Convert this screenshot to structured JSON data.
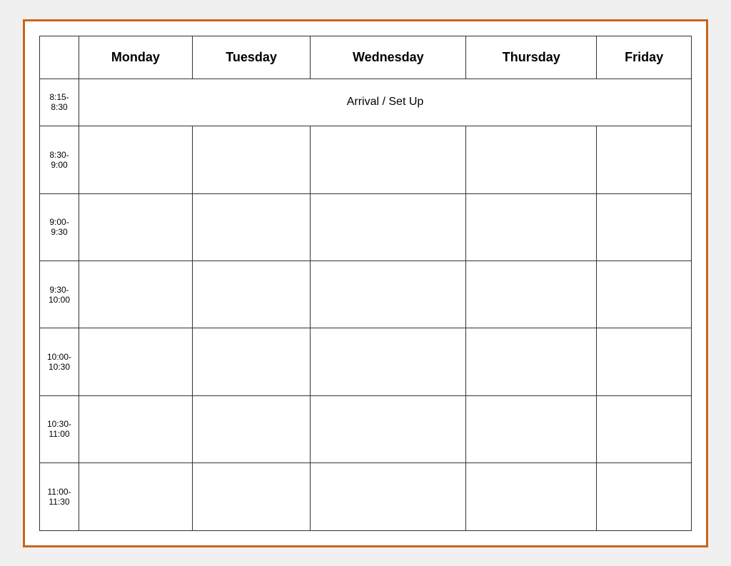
{
  "table": {
    "headers": [
      "",
      "Monday",
      "Tuesday",
      "Wednesday",
      "Thursday",
      "Friday"
    ],
    "arrival_label": "Arrival / Set Up",
    "rows": [
      {
        "time": "8:15-\n8:30",
        "is_arrival": true
      },
      {
        "time": "8:30-\n9:00",
        "is_arrival": false
      },
      {
        "time": "9:00-\n9:30",
        "is_arrival": false
      },
      {
        "time": "9:30-\n10:00",
        "is_arrival": false
      },
      {
        "time": "10:00-\n10:30",
        "is_arrival": false
      },
      {
        "time": "10:30-\n11:00",
        "is_arrival": false
      },
      {
        "time": "11:00-\n11:30",
        "is_arrival": false
      }
    ]
  }
}
